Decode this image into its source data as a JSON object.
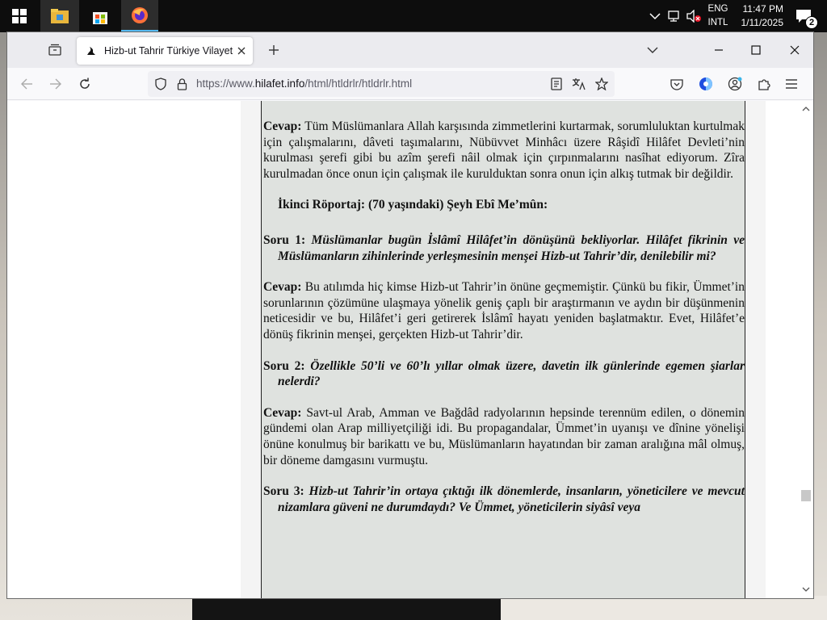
{
  "taskbar": {
    "tray": {
      "language_top": "ENG",
      "language_bottom": "INTL",
      "time": "11:47 PM",
      "date": "1/11/2025",
      "notification_count": "2"
    }
  },
  "browser": {
    "tab": {
      "title": "Hizb-ut Tahrir Türkiye Vilayeti R..."
    },
    "url": {
      "prefix": "https://www.",
      "domain": "hilafet.info",
      "path": "/html/htldrlr/htldrlr.html"
    }
  },
  "document": {
    "p1": {
      "lead": "Cevap:",
      "text": " Tüm Müslümanlara Allah karşısında zimmetlerini kurtarmak, sorumluluktan kurtulmak için çalışmalarını, dâveti taşımalarını, Nübüvvet Minhâcı üzere Râşidî Hilâfet Devleti’nin kurulması şerefi gibi bu azîm şerefi nâil olmak için çırpınmalarını nasîhat ediyorum. Zîra kurulmadan önce onun için çalışmak ile kurulduktan sonra onun için alkış tutmak bir değildir."
    },
    "heading": "İkinci Röportaj: (70 yaşındaki) Şeyh Ebî Me’mûn:",
    "q1": {
      "lead": "Soru 1:",
      "text": " Müslümanlar bugün İslâmî Hilâfet’in dönüşünü bekliyorlar. Hilâfet fikrinin ve Müslümanların zihinlerinde yerleşmesinin menşei Hizb-ut Tahrir’dir, denilebilir mi?"
    },
    "a1": {
      "lead": "Cevap:",
      "text": " Bu atılımda hiç kimse Hizb-ut Tahrir’in önüne geçmemiştir. Çünkü bu fikir, Ümmet’in sorunlarının çözümüne ulaşmaya yönelik geniş çaplı bir araştırmanın ve aydın bir düşünmenin neticesidir ve bu, Hilâfet’i geri getirerek İslâmî hayatı yeniden başlatmaktır. Evet, Hilâfet’e dönüş fikrinin menşei, gerçekten Hizb-ut Tahrir’dir."
    },
    "q2": {
      "lead": "Soru 2:",
      "text": " Özellikle 50’li ve 60’lı yıllar olmak üzere, davetin ilk günlerinde egemen şiarlar nelerdi?"
    },
    "a2": {
      "lead": "Cevap:",
      "text": " Savt-ul Arab, Amman ve Bağdâd radyolarının hepsinde terennüm edilen, o dönemin gündemi olan Arap milliyetçiliği idi. Bu propagandalar, Ümmet’in uyanışı ve dînine yönelişi önüne konulmuş bir barikattı ve bu, Müslümanların hayatından bir zaman aralığına mâl olmuş, bir döneme damgasını vurmuştu."
    },
    "q3": {
      "lead": "Soru 3:",
      "text": " Hizb-ut Tahrir’in ortaya çıktığı ilk dönemlerde, insanların, yöneticilere ve mevcut nizamlara güveni ne durumdaydı? Ve Ümmet, yöneticilerin siyâsî veya"
    }
  }
}
